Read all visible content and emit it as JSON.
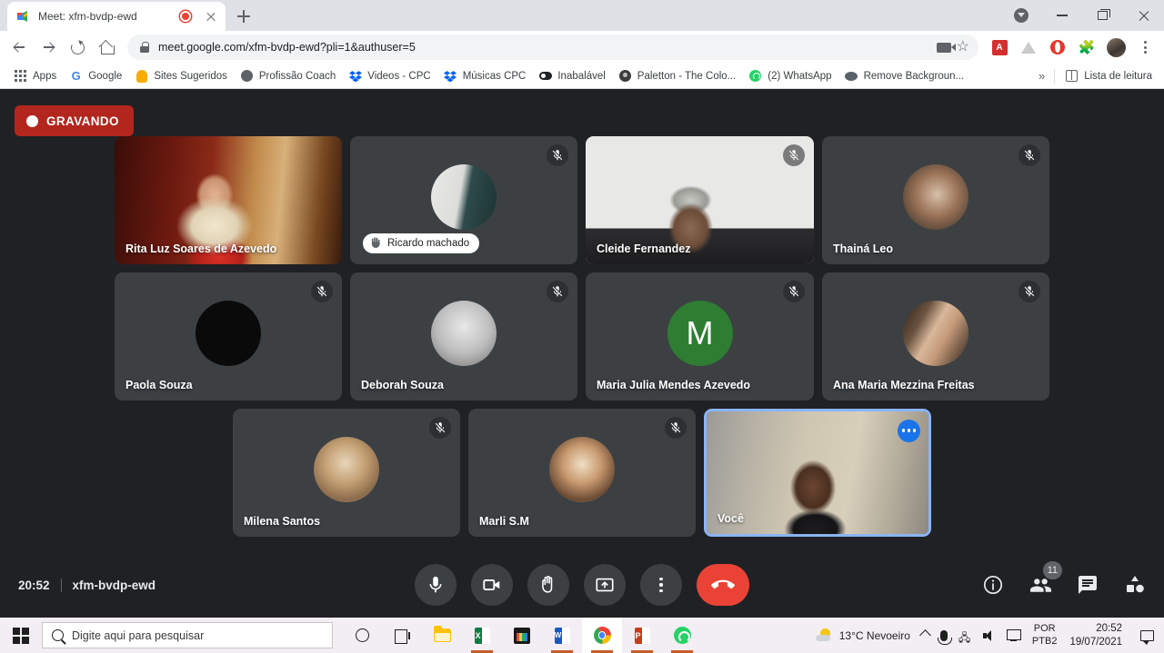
{
  "browser": {
    "tab": {
      "title": "Meet: xfm-bvdp-ewd",
      "favicon_name": "google-meet-favicon",
      "recording_indicator": "recording"
    },
    "url": "meet.google.com/xfm-bvdp-ewd?pli=1&authuser=5",
    "bookmarks": [
      {
        "label": "Apps",
        "icon": "apps-grid-icon"
      },
      {
        "label": "Google",
        "icon": "google-g-icon"
      },
      {
        "label": "Sites Sugeridos",
        "icon": "bulb-icon"
      },
      {
        "label": "Profissão Coach",
        "icon": "globe-icon"
      },
      {
        "label": "Videos - CPC",
        "icon": "dropbox-icon"
      },
      {
        "label": "Músicas CPC",
        "icon": "dropbox-icon"
      },
      {
        "label": "Inabalável",
        "icon": "black-pill-icon"
      },
      {
        "label": "Paletton - The Colo...",
        "icon": "paletton-icon"
      },
      {
        "label": "(2) WhatsApp",
        "icon": "whatsapp-icon"
      },
      {
        "label": "Remove Backgroun...",
        "icon": "removebg-icon"
      }
    ],
    "overflow_label": "»",
    "reading_list_label": "Lista de leitura"
  },
  "meet": {
    "recording_badge": "GRAVANDO",
    "time": "20:52",
    "meeting_code": "xfm-bvdp-ewd",
    "participant_count": "11",
    "self_label": "Você",
    "accent_color": "#8ab4f8",
    "recording_color": "#b3261e",
    "hangup_color": "#ea4335",
    "rows": [
      [
        {
          "name": "Rita Luz Soares de Azevedo",
          "kind": "video",
          "bg": "bg-rita",
          "muted": false,
          "hand_raised": false
        },
        {
          "name": "Ricardo machado",
          "kind": "avatar",
          "bg": "bg-ricardo",
          "muted": true,
          "hand_raised": true
        },
        {
          "name": "Cleide Fernandez",
          "kind": "video",
          "bg": "bg-cleide",
          "muted": true,
          "hand_raised": false
        },
        {
          "name": "Thainá Leo",
          "kind": "avatar",
          "bg": "bg-thaina",
          "muted": true,
          "hand_raised": false
        }
      ],
      [
        {
          "name": "Paola Souza",
          "kind": "avatar",
          "bg": "bg-black",
          "muted": true,
          "hand_raised": false
        },
        {
          "name": "Deborah Souza",
          "kind": "avatar",
          "bg": "bg-deborah",
          "muted": true,
          "hand_raised": false
        },
        {
          "name": "Maria Julia Mendes Azevedo",
          "kind": "initial",
          "initial": "M",
          "bg": "bg-green",
          "muted": true,
          "hand_raised": false
        },
        {
          "name": "Ana Maria Mezzina Freitas",
          "kind": "avatar",
          "bg": "bg-ana",
          "muted": true,
          "hand_raised": false
        }
      ],
      [
        {
          "name": "Milena Santos",
          "kind": "avatar",
          "bg": "bg-milena",
          "muted": true,
          "hand_raised": false
        },
        {
          "name": "Marli S.M",
          "kind": "avatar",
          "bg": "bg-marli",
          "muted": true,
          "hand_raised": false
        },
        {
          "name": "Você",
          "kind": "video",
          "bg": "bg-voce",
          "muted": false,
          "hand_raised": false,
          "self": true,
          "more_options": true
        }
      ]
    ],
    "controls": [
      {
        "name": "microphone-button",
        "icon": "microphone-icon"
      },
      {
        "name": "camera-button",
        "icon": "camera-icon"
      },
      {
        "name": "raise-hand-button",
        "icon": "raised-hand-icon"
      },
      {
        "name": "present-screen-button",
        "icon": "present-screen-icon"
      },
      {
        "name": "more-options-button",
        "icon": "kebab-menu-icon"
      },
      {
        "name": "leave-call-button",
        "icon": "hangup-phone-icon"
      }
    ],
    "right_controls": [
      {
        "name": "meeting-details-button",
        "icon": "info-icon"
      },
      {
        "name": "show-everyone-button",
        "icon": "people-icon"
      },
      {
        "name": "chat-button",
        "icon": "chat-icon"
      },
      {
        "name": "activities-button",
        "icon": "activities-icon"
      }
    ]
  },
  "taskbar": {
    "search_placeholder": "Digite aqui para pesquisar",
    "apps": [
      {
        "name": "cortana-button",
        "icon": "cortana-icon"
      },
      {
        "name": "task-view-button",
        "icon": "task-view-icon"
      },
      {
        "name": "file-explorer-button",
        "icon": "folder-icon"
      },
      {
        "name": "excel-button",
        "icon": "excel-icon"
      },
      {
        "name": "dark-app-button",
        "icon": "dark-app-icon"
      },
      {
        "name": "word-button",
        "icon": "word-icon"
      },
      {
        "name": "chrome-button",
        "icon": "chrome-icon"
      },
      {
        "name": "powerpoint-button",
        "icon": "powerpoint-icon"
      },
      {
        "name": "whatsapp-button",
        "icon": "whatsapp-icon"
      }
    ],
    "weather": "13°C  Nevoeiro",
    "lang_top": "POR",
    "lang_bottom": "PTB2",
    "clock_time": "20:52",
    "clock_date": "19/07/2021"
  }
}
